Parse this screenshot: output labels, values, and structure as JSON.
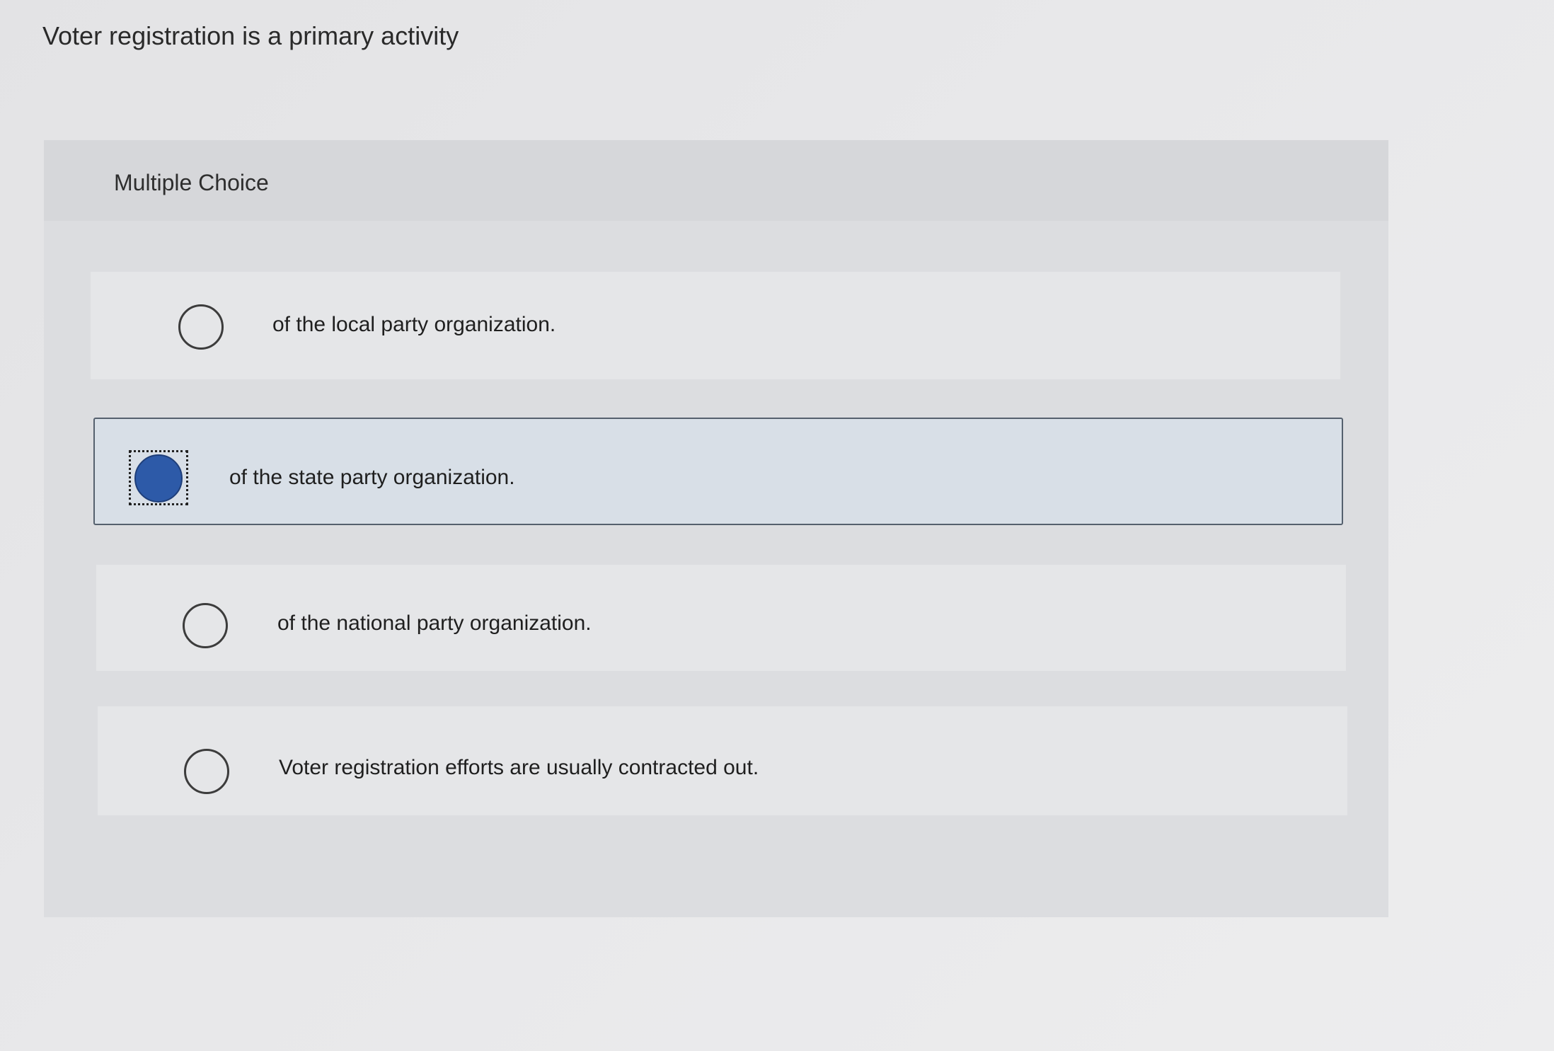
{
  "question": {
    "text": "Voter registration is a primary activity"
  },
  "multiple_choice": {
    "header": "Multiple Choice",
    "options": [
      {
        "label": "of the local party organization.",
        "selected": false
      },
      {
        "label": "of the state party organization.",
        "selected": true
      },
      {
        "label": "of the national party organization.",
        "selected": false
      },
      {
        "label": "Voter registration efforts are usually contracted out.",
        "selected": false
      }
    ]
  },
  "colors": {
    "selected_radio": "#2d5aa8",
    "selected_option_bg": "#d8dfe7"
  }
}
